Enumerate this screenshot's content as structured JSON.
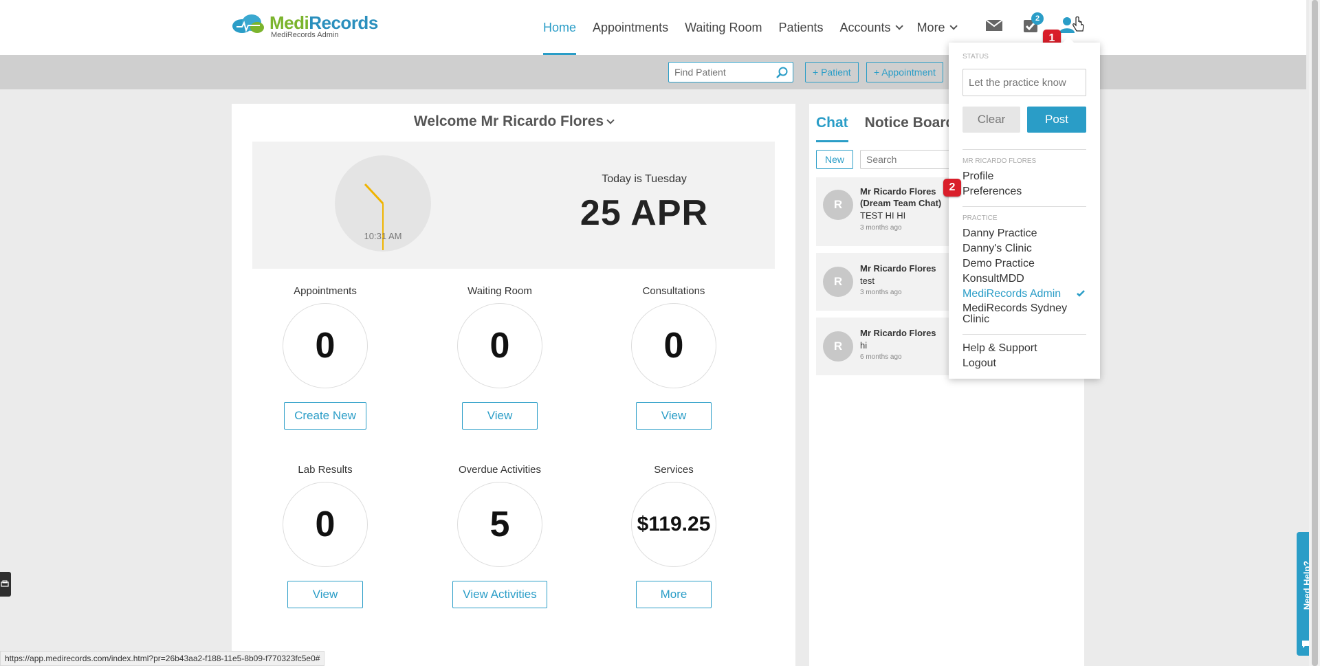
{
  "header": {
    "logo": {
      "brand_a": "Medi",
      "brand_b": "Records",
      "sub": "MediRecords Admin"
    },
    "nav": [
      {
        "label": "Home",
        "active": true
      },
      {
        "label": "Appointments"
      },
      {
        "label": "Waiting Room"
      },
      {
        "label": "Patients"
      },
      {
        "label": "Accounts",
        "dropdown": true
      },
      {
        "label": "More",
        "dropdown": true
      }
    ],
    "icons": {
      "mail": "mail-icon",
      "tasks": "tasks-check-icon",
      "user": "user-icon"
    },
    "tasks_badge": "2",
    "step_markers": [
      "1",
      "2"
    ]
  },
  "toolbar": {
    "find_patient_placeholder": "Find Patient",
    "add_patient": "+ Patient",
    "add_appointment": "+ Appointment"
  },
  "welcome": {
    "title": "Welcome Mr Ricardo Flores",
    "clock_time": "10:31 AM",
    "today": "Today is Tuesday",
    "date": "25 APR"
  },
  "stats": [
    {
      "label": "Appointments",
      "value": "0",
      "button": "Create New"
    },
    {
      "label": "Waiting Room",
      "value": "0",
      "button": "View"
    },
    {
      "label": "Consultations",
      "value": "0",
      "button": "View"
    },
    {
      "label": "Lab Results",
      "value": "0",
      "button": "View"
    },
    {
      "label": "Overdue Activities",
      "value": "5",
      "button": "View Activities"
    },
    {
      "label": "Services",
      "value": "$119.25",
      "button": "More"
    }
  ],
  "chat": {
    "tabs": [
      "Chat",
      "Notice Board"
    ],
    "new_button": "New",
    "search_placeholder": "Search",
    "items": [
      {
        "avatar": "R",
        "name": "Mr Ricardo Flores (Dream Team Chat)",
        "message": "TEST HI HI",
        "time": "3 months ago"
      },
      {
        "avatar": "R",
        "name": "Mr Ricardo Flores",
        "message": "test",
        "time": "3 months ago"
      },
      {
        "avatar": "R",
        "name": "Mr Ricardo Flores",
        "message": "hi",
        "time": "6 months ago"
      }
    ]
  },
  "user_menu": {
    "status_heading": "STATUS",
    "status_placeholder": "Let the practice know",
    "clear": "Clear",
    "post": "Post",
    "user_heading": "MR RICARDO FLORES",
    "profile": "Profile",
    "preferences": "Preferences",
    "practice_heading": "PRACTICE",
    "practices": [
      {
        "label": "Danny Practice"
      },
      {
        "label": "Danny's Clinic"
      },
      {
        "label": "Demo Practice"
      },
      {
        "label": "KonsultMDD"
      },
      {
        "label": "MediRecords Admin",
        "selected": true
      },
      {
        "label": "MediRecords Sydney Clinic"
      }
    ],
    "help": "Help & Support",
    "logout": "Logout"
  },
  "status_url": "https://app.medirecords.com/index.html?pr=26b43aa2-f188-11e5-8b09-f770323fc5e0#",
  "need_help": "Need Help?",
  "colors": {
    "accent": "#2a9dc7",
    "brand_green": "#7bb42d",
    "marker_red": "#d91e2a",
    "clock_hand": "#f0b400"
  }
}
